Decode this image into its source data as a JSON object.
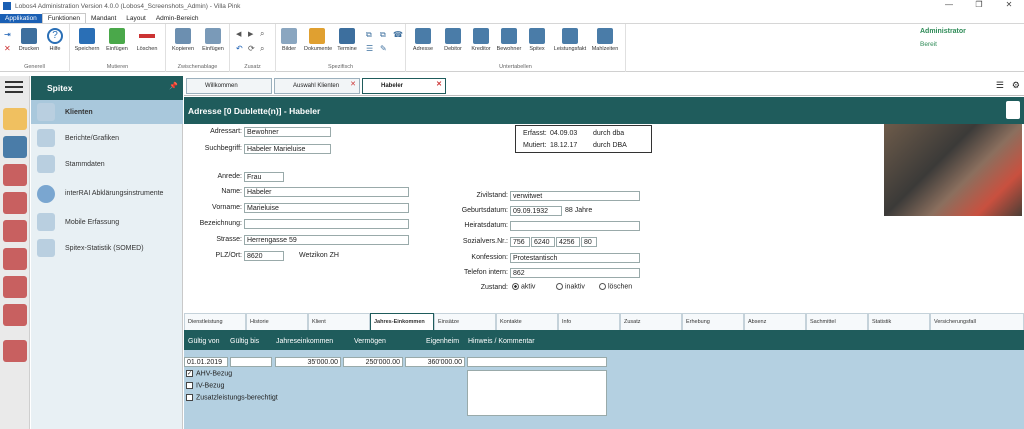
{
  "window": {
    "title": "Lobos4 Administration Version 4.0.0 (Lobos4_Screenshots_Admin) - Villa Pink",
    "minimize": "—",
    "maximize": "❐",
    "close": "✕"
  },
  "menu": {
    "tabs": [
      "Applikation",
      "Funktionen",
      "Mandant",
      "Layout",
      "Admin-Bereich"
    ]
  },
  "ribbon": {
    "groups": [
      {
        "label": "Generell",
        "buttons": [
          "Drucken",
          "Hilfe"
        ]
      },
      {
        "label": "Mutieren",
        "buttons": [
          "Speichern",
          "Einfügen",
          "Löschen"
        ]
      },
      {
        "label": "Zwischenablage",
        "buttons": [
          "Kopieren",
          "Einfügen"
        ]
      },
      {
        "label": "Zusatz",
        "buttons": []
      },
      {
        "label": "Spezifisch",
        "buttons": [
          "Bilder",
          "Dokumente",
          "Termine"
        ]
      },
      {
        "label": "Untertabellen",
        "buttons": [
          "Adresse",
          "Debitor",
          "Kreditor",
          "Bewohner",
          "Spitex",
          "Leistungsfakt",
          "Mahlzeiten"
        ]
      }
    ],
    "user": "Administrator",
    "status": "Bereit"
  },
  "nav": {
    "title": "Spitex",
    "items": [
      "Klienten",
      "Berichte/Grafiken",
      "Stammdaten",
      "interRAI Abklärungsinstrumente",
      "Mobile Erfassung",
      "Spitex-Statistik (SOMED)"
    ]
  },
  "doctabs": [
    "Willkommen",
    "Auswahl Klienten",
    "Habeler"
  ],
  "header": {
    "title": "Adresse [0 Dublette(n)] - Habeler"
  },
  "form": {
    "adressart_label": "Adressart:",
    "adressart": "Bewohner",
    "suchbegriff_label": "Suchbegriff:",
    "suchbegriff": "Habeler Marieluise",
    "anrede_label": "Anrede:",
    "anrede": "Frau",
    "name_label": "Name:",
    "name": "Habeler",
    "vorname_label": "Vorname:",
    "vorname": "Marieluise",
    "bezeichnung_label": "Bezeichnung:",
    "bezeichnung": "",
    "strasse_label": "Strasse:",
    "strasse": "Herrengasse 59",
    "plzort_label": "PLZ/Ort:",
    "plz": "8620",
    "ort": "Wetzikon ZH",
    "erfasst_label": "Erfasst:",
    "erfasst": "04.09.03",
    "erfasst_by": "durch dba",
    "mutiert_label": "Mutiert:",
    "mutiert": "18.12.17",
    "mutiert_by": "durch DBA",
    "zivilstand_label": "Zivilstand:",
    "zivilstand": "verwitwet",
    "geburtsdatum_label": "Geburtsdatum:",
    "geburtsdatum": "09.09.1932",
    "alter": "88 Jahre",
    "heiratsdatum_label": "Heiratsdatum:",
    "heiratsdatum": "",
    "sozialvers_label": "Sozialvers.Nr.:",
    "sv1": "756",
    "sv2": "6240",
    "sv3": "4256",
    "sv4": "80",
    "konfession_label": "Konfession:",
    "konfession": "Protestantisch",
    "telefon_label": "Telefon intern:",
    "telefon": "862",
    "zustand_label": "Zustand:",
    "zustand_options": [
      "aktiv",
      "inaktiv",
      "löschen"
    ]
  },
  "subtabs": [
    "Dienstleistung",
    "Historie",
    "Klient",
    "Jahres-Einkommen",
    "Einsätze",
    "Kontakte",
    "Info",
    "Zusatz",
    "Erhebung",
    "Absenz",
    "Sachmittel",
    "Statistik",
    "Versicherungsfall"
  ],
  "income": {
    "headers": [
      "Gültig von",
      "Gültig bis",
      "Jahreseinkommen",
      "Vermögen",
      "Eigenheim",
      "Hinweis / Kommentar"
    ],
    "gueltig_von": "01.01.2019",
    "gueltig_bis": "",
    "jahreseinkommen": "35'000.00",
    "vermoegen": "250'000.00",
    "eigenheim": "360'000.00",
    "hinweis": "",
    "checks": [
      {
        "label": "AHV-Bezug",
        "checked": true
      },
      {
        "label": "IV-Bezug",
        "checked": false
      },
      {
        "label": "Zusatzleistungs-berechtigt",
        "checked": false
      }
    ]
  }
}
